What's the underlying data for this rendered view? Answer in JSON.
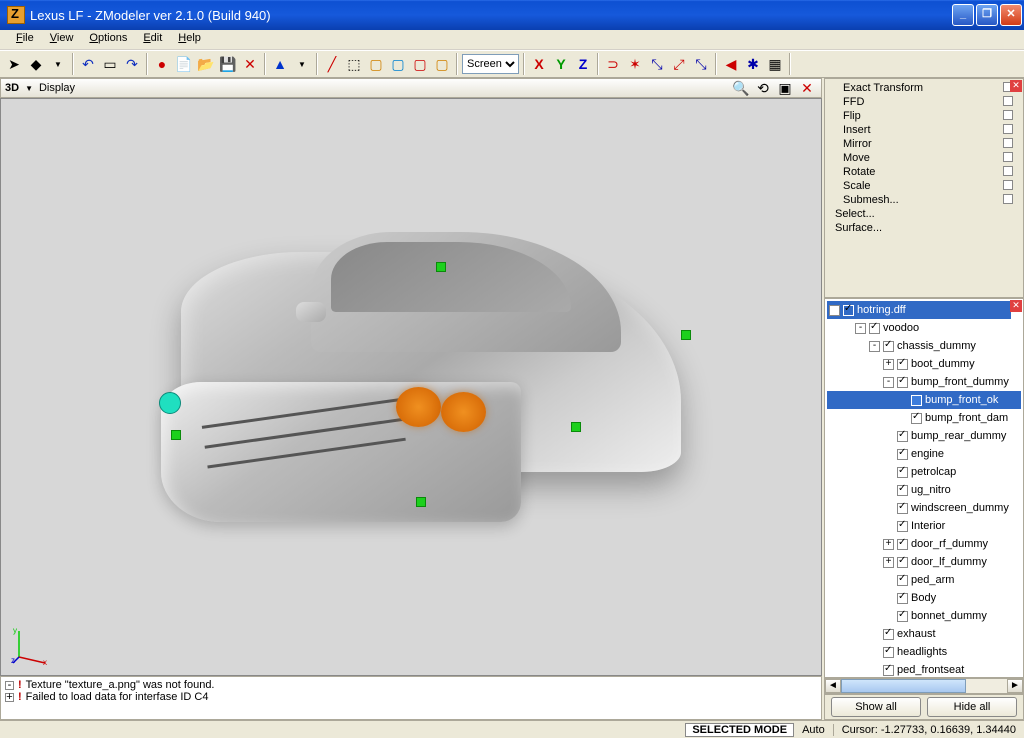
{
  "title": "Lexus LF  - ZModeler ver 2.1.0 (Build 940)",
  "menu": [
    "File",
    "View",
    "Options",
    "Edit",
    "Help"
  ],
  "vp": {
    "left": "3D",
    "display": "Display"
  },
  "tb_select": "Screen",
  "modify": {
    "items": [
      "Exact Transform",
      "FFD",
      "Flip",
      "Insert",
      "Mirror",
      "Move",
      "Rotate",
      "Scale",
      "Submesh..."
    ],
    "less_indent": [
      "Select...",
      "Surface..."
    ]
  },
  "tree": {
    "root": "hotring.dff",
    "nodes": [
      {
        "pad": 2,
        "exp": "-",
        "chk": true,
        "label": "voodoo"
      },
      {
        "pad": 3,
        "exp": "-",
        "chk": true,
        "label": "chassis_dummy"
      },
      {
        "pad": 4,
        "exp": "+",
        "chk": true,
        "label": "boot_dummy"
      },
      {
        "pad": 4,
        "exp": "-",
        "chk": true,
        "label": "bump_front_dummy"
      },
      {
        "pad": 5,
        "exp": "",
        "chk": "blue",
        "label": "bump_front_ok",
        "sel": true
      },
      {
        "pad": 5,
        "exp": "",
        "chk": true,
        "label": "bump_front_dam"
      },
      {
        "pad": 4,
        "exp": "",
        "chk": true,
        "label": "bump_rear_dummy"
      },
      {
        "pad": 4,
        "exp": "",
        "chk": true,
        "label": "engine"
      },
      {
        "pad": 4,
        "exp": "",
        "chk": true,
        "label": "petrolcap"
      },
      {
        "pad": 4,
        "exp": "",
        "chk": true,
        "label": "ug_nitro"
      },
      {
        "pad": 4,
        "exp": "",
        "chk": true,
        "label": "windscreen_dummy"
      },
      {
        "pad": 4,
        "exp": "",
        "chk": true,
        "label": "Interior"
      },
      {
        "pad": 4,
        "exp": "+",
        "chk": true,
        "label": "door_rf_dummy"
      },
      {
        "pad": 4,
        "exp": "+",
        "chk": true,
        "label": "door_lf_dummy"
      },
      {
        "pad": 4,
        "exp": "",
        "chk": true,
        "label": "ped_arm"
      },
      {
        "pad": 4,
        "exp": "",
        "chk": true,
        "label": "Body"
      },
      {
        "pad": 4,
        "exp": "",
        "chk": true,
        "label": "bonnet_dummy"
      },
      {
        "pad": 3,
        "exp": "",
        "chk": true,
        "label": "exhaust"
      },
      {
        "pad": 3,
        "exp": "",
        "chk": true,
        "label": "headlights"
      },
      {
        "pad": 3,
        "exp": "",
        "chk": true,
        "label": "ped_frontseat"
      }
    ]
  },
  "btns": {
    "show": "Show all",
    "hide": "Hide all"
  },
  "msgs": [
    "Texture \"texture_a.png\" was not found.",
    "Failed to load data for interfase ID C4"
  ],
  "status": {
    "mode": "SELECTED MODE",
    "auto": "Auto",
    "cursor": "Cursor: -1.27733, 0.16639, 1.34440"
  }
}
